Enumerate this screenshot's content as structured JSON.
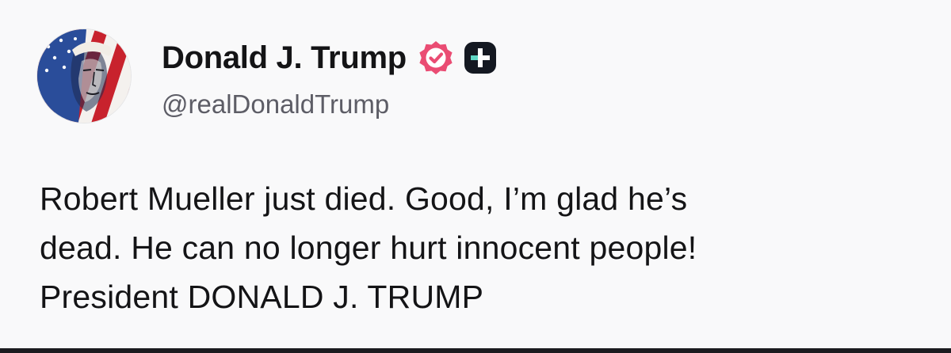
{
  "author": {
    "display_name": "Donald J. Trump",
    "handle": "@realDonaldTrump",
    "avatar_icon": "portrait-flag-avatar",
    "verified_icon": "verified-badge-icon",
    "verified_color": "#ea4c73",
    "plus_icon": "plus-badge-icon",
    "plus_badge_color": "#141821",
    "plus_accent_color": "#5fd6c4"
  },
  "post": {
    "lines": [
      "Robert Mueller just died. Good, I’m glad he’s",
      "dead. He can no longer hurt innocent people!",
      "President DONALD J. TRUMP"
    ]
  }
}
